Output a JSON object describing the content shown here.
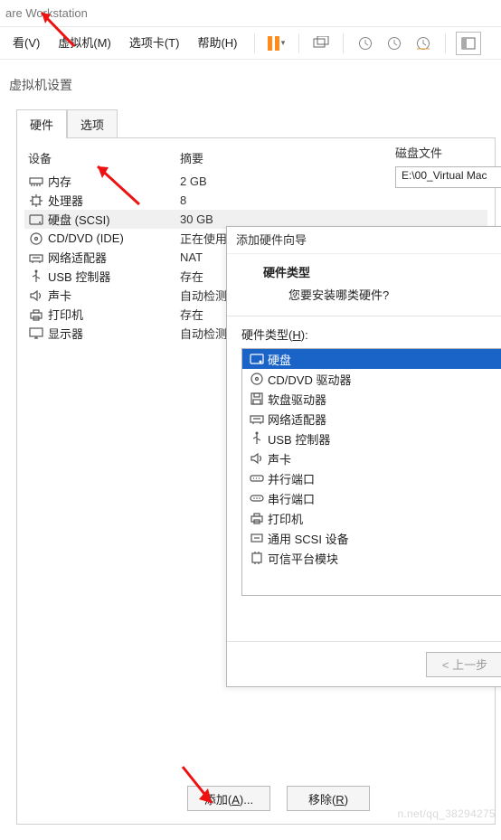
{
  "window": {
    "title": "are Workstation"
  },
  "menu": {
    "view": "看(V)",
    "vm": "虚拟机(M)",
    "tabs": "选项卡(T)",
    "help": "帮助(H)"
  },
  "settings": {
    "title": "虚拟机设置",
    "tabs": {
      "hardware": "硬件",
      "options": "选项"
    },
    "header": {
      "device": "设备",
      "summary": "摘要"
    },
    "devices": [
      {
        "icon": "memory",
        "name": "内存",
        "summary": "2 GB"
      },
      {
        "icon": "cpu",
        "name": "处理器",
        "summary": "8"
      },
      {
        "icon": "disk",
        "name": "硬盘 (SCSI)",
        "summary": "30 GB",
        "selected": true
      },
      {
        "icon": "cd",
        "name": "CD/DVD (IDE)",
        "summary": "正在使用"
      },
      {
        "icon": "net",
        "name": "网络适配器",
        "summary": "NAT"
      },
      {
        "icon": "usb",
        "name": "USB 控制器",
        "summary": "存在"
      },
      {
        "icon": "sound",
        "name": "声卡",
        "summary": "自动检测"
      },
      {
        "icon": "printer",
        "name": "打印机",
        "summary": "存在"
      },
      {
        "icon": "display",
        "name": "显示器",
        "summary": "自动检测"
      }
    ],
    "diskfile": {
      "label": "磁盘文件",
      "value": "E:\\00_Virtual Mac"
    },
    "buttons": {
      "add": "添加(A)...",
      "remove": "移除(R)"
    }
  },
  "wizard": {
    "title": "添加硬件向导",
    "heading": "硬件类型",
    "sub": "您要安装哪类硬件?",
    "list_label": "硬件类型(H):",
    "items": [
      {
        "icon": "disk",
        "label": "硬盘",
        "selected": true
      },
      {
        "icon": "cd",
        "label": "CD/DVD 驱动器"
      },
      {
        "icon": "floppy",
        "label": "软盘驱动器"
      },
      {
        "icon": "net",
        "label": "网络适配器"
      },
      {
        "icon": "usb",
        "label": "USB 控制器"
      },
      {
        "icon": "sound",
        "label": "声卡"
      },
      {
        "icon": "parallel",
        "label": "并行端口"
      },
      {
        "icon": "serial",
        "label": "串行端口"
      },
      {
        "icon": "printer",
        "label": "打印机"
      },
      {
        "icon": "scsi",
        "label": "通用 SCSI 设备"
      },
      {
        "icon": "tpm",
        "label": "可信平台模块"
      }
    ],
    "back": "< 上一步"
  },
  "watermark": "n.net/qq_38294275"
}
